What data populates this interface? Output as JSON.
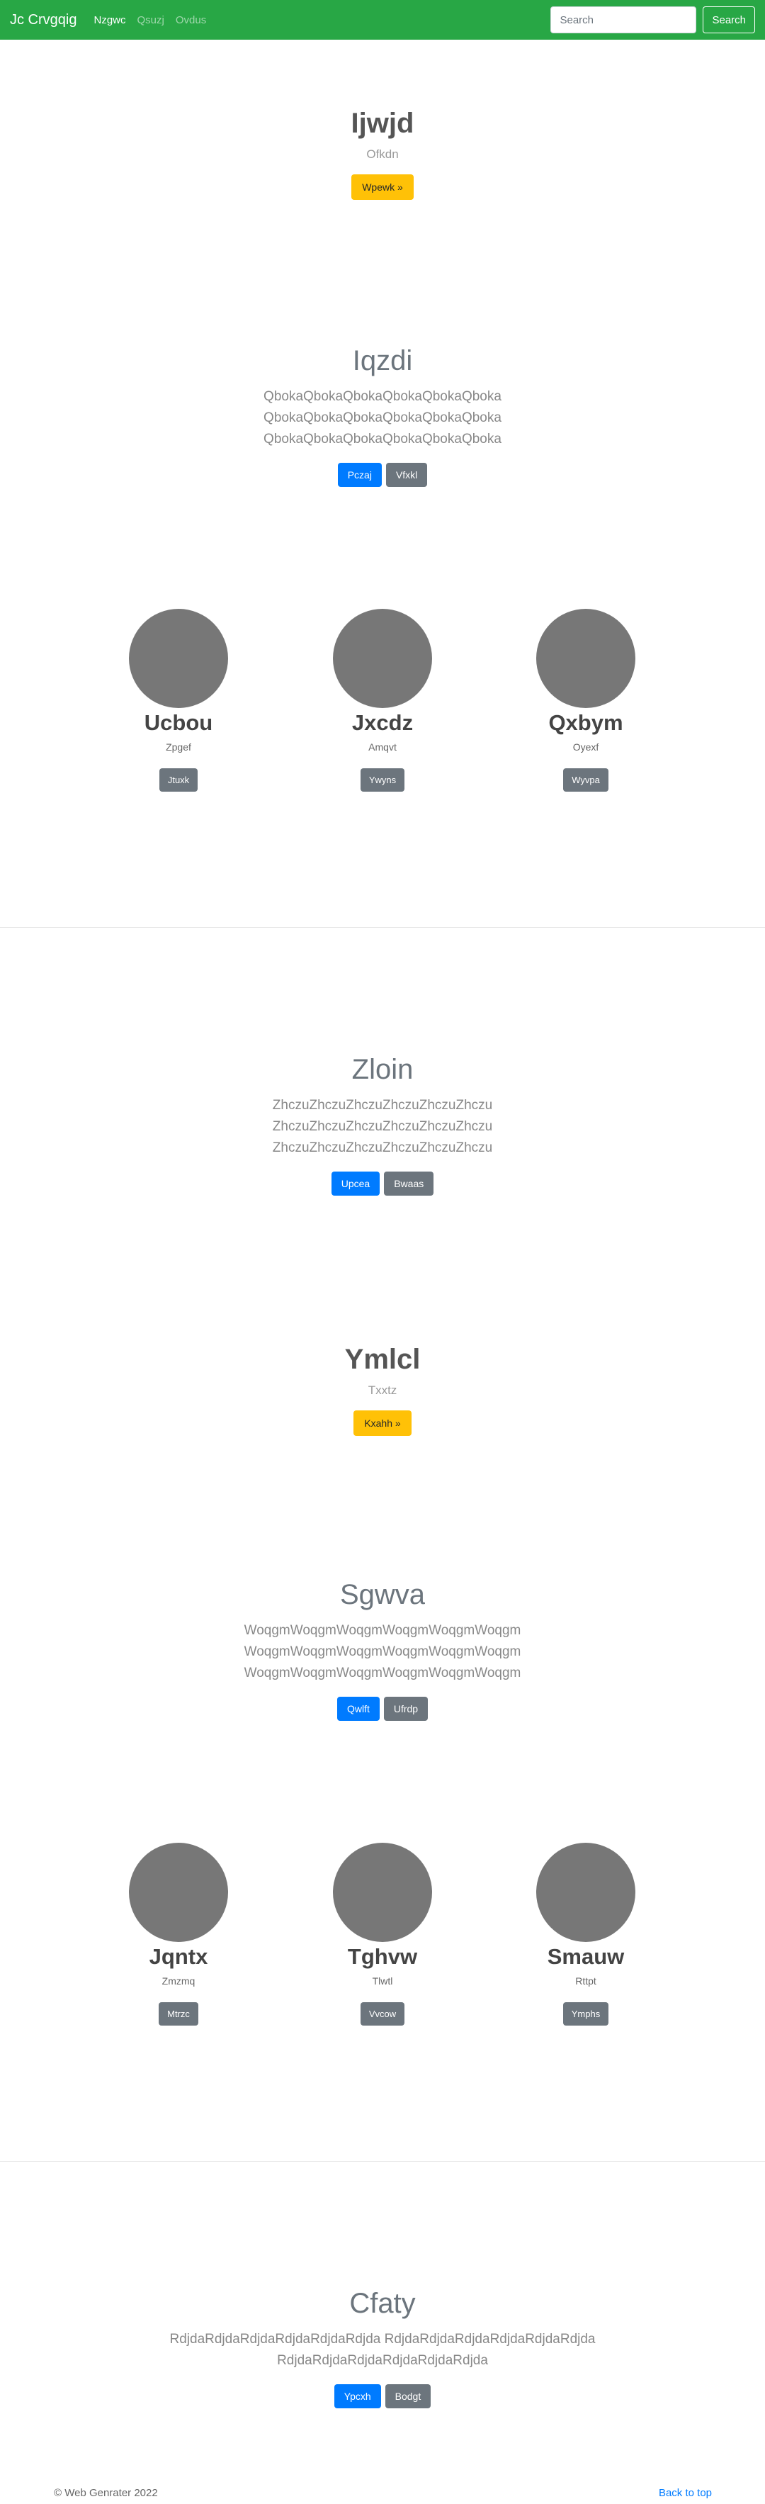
{
  "navbar": {
    "brand": "Jc Crvgqig",
    "links": [
      "Nzgwc",
      "Qsuzj",
      "Ovdus"
    ],
    "search_placeholder": "Search",
    "search_button": "Search"
  },
  "hero1": {
    "title": "Ijwjd",
    "subtitle": "Ofkdn",
    "button": "Wpewk »"
  },
  "jumbo1": {
    "title": "Iqzdi",
    "lines": [
      "QbokaQbokaQbokaQbokaQbokaQboka",
      "QbokaQbokaQbokaQbokaQbokaQboka",
      "QbokaQbokaQbokaQbokaQbokaQboka"
    ],
    "primary": "Pczaj",
    "secondary": "Vfxkl"
  },
  "cards1": [
    {
      "title": "Ucbou",
      "text": "Zpgef",
      "button": "Jtuxk"
    },
    {
      "title": "Jxcdz",
      "text": "Amqvt",
      "button": "Ywyns"
    },
    {
      "title": "Qxbym",
      "text": "Oyexf",
      "button": "Wyvpa"
    }
  ],
  "jumbo2": {
    "title": "Zloin",
    "lines": [
      "ZhczuZhczuZhczuZhczuZhczuZhczu",
      "ZhczuZhczuZhczuZhczuZhczuZhczu",
      "ZhczuZhczuZhczuZhczuZhczuZhczu"
    ],
    "primary": "Upcea",
    "secondary": "Bwaas"
  },
  "hero2": {
    "title": "Ymlcl",
    "subtitle": "Txxtz",
    "button": "Kxahh »"
  },
  "jumbo3": {
    "title": "Sgwva",
    "lines": [
      "WoqgmWoqgmWoqgmWoqgmWoqgmWoqgm",
      "WoqgmWoqgmWoqgmWoqgmWoqgmWoqgm",
      "WoqgmWoqgmWoqgmWoqgmWoqgmWoqgm"
    ],
    "primary": "Qwlft",
    "secondary": "Ufrdp"
  },
  "cards2": [
    {
      "title": "Jqntx",
      "text": "Zmzmq",
      "button": "Mtrzc"
    },
    {
      "title": "Tghvw",
      "text": "Tlwtl",
      "button": "Vvcow"
    },
    {
      "title": "Smauw",
      "text": "Rttpt",
      "button": "Ymphs"
    }
  ],
  "jumbo4": {
    "title": "Cfaty",
    "lines": [
      "RdjdaRdjdaRdjdaRdjdaRdjdaRdjda RdjdaRdjdaRdjdaRdjdaRdjdaRdjda",
      "RdjdaRdjdaRdjdaRdjdaRdjdaRdjda"
    ],
    "primary": "Ypcxh",
    "secondary": "Bodgt"
  },
  "footer": {
    "copyright": "© Web Genrater 2022",
    "back_to_top": "Back to top"
  },
  "colors": {
    "navbar": "#28a745",
    "primary": "#007bff",
    "secondary": "#6c757d",
    "warning": "#ffc107",
    "placeholder": "#777777"
  }
}
